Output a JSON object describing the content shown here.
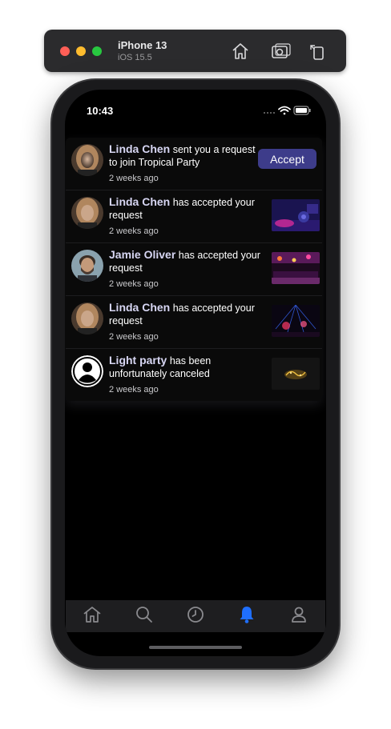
{
  "simulator": {
    "device": "iPhone 13",
    "os": "iOS 15.5",
    "buttons": [
      "home-icon",
      "screenshot-icon",
      "rotate-icon"
    ]
  },
  "status_bar": {
    "time": "10:43"
  },
  "notifications": [
    {
      "name": "Linda Chen",
      "message": "sent you a request to join Tropical Party",
      "time": "2 weeks ago",
      "avatar": "linda-avatar",
      "action": "Accept"
    },
    {
      "name": "Linda Chen",
      "message": "has accepted your request",
      "time": "2 weeks ago",
      "avatar": "linda-avatar",
      "thumbnail": "dj-booth-photo"
    },
    {
      "name": "Jamie Oliver",
      "message": "has accepted your request",
      "time": "2 weeks ago",
      "avatar": "jamie-avatar",
      "thumbnail": "bar-lights-photo"
    },
    {
      "name": "Linda Chen",
      "message": "has accepted your request",
      "time": "2 weeks ago",
      "avatar": "linda-avatar",
      "thumbnail": "concert-lights-photo"
    },
    {
      "name": "Light party",
      "message": "has been unfortunately canceled",
      "time": "2 weeks ago",
      "avatar": "default-user-avatar",
      "thumbnail": "light-party-logo"
    }
  ],
  "tab_bar": {
    "tabs": [
      "home-icon",
      "search-icon",
      "clock-icon",
      "bell-icon",
      "profile-icon"
    ],
    "active": "bell-icon"
  },
  "colors": {
    "accent": "#3d3c8a",
    "active_tab": "#1f6fff",
    "name_text": "#d7d6f3",
    "background": "#000000"
  }
}
